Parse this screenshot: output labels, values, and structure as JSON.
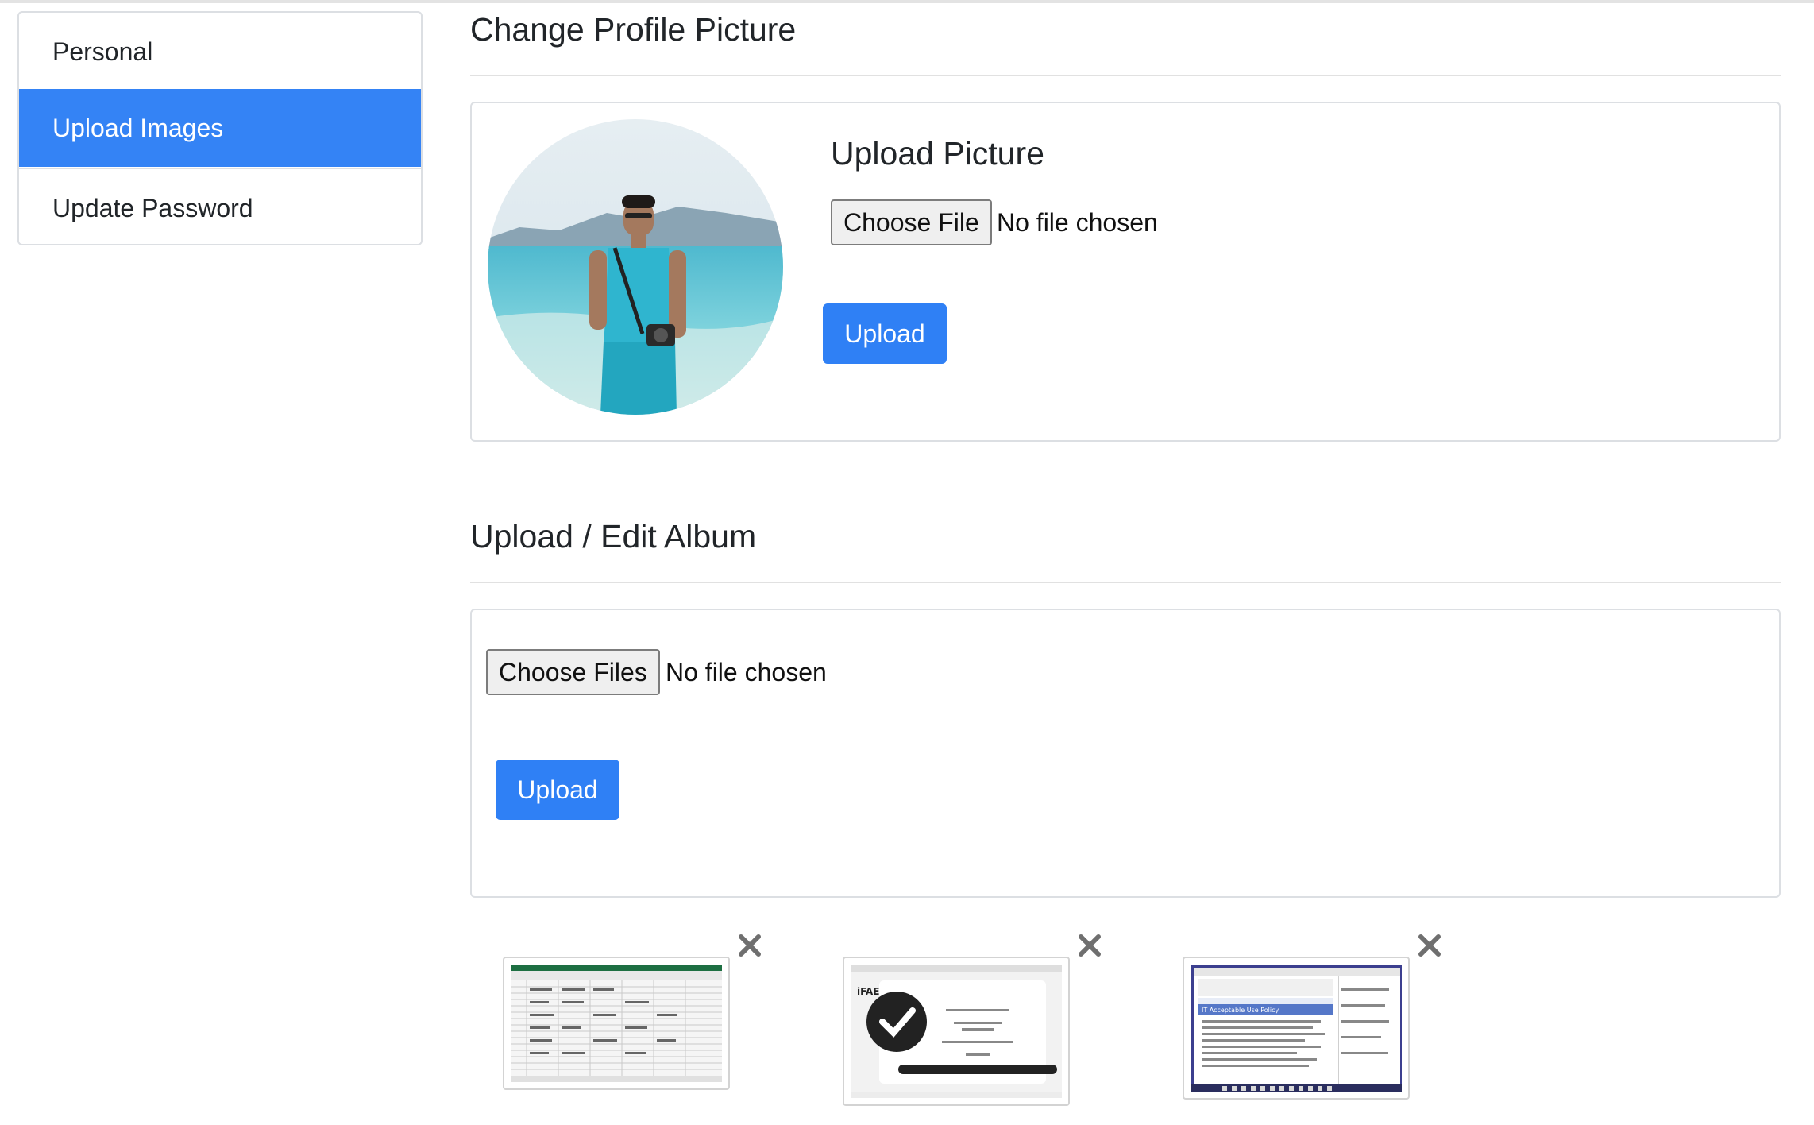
{
  "sidebar": {
    "items": [
      {
        "label": "Personal"
      },
      {
        "label": "Upload Images"
      },
      {
        "label": "Update Password"
      }
    ]
  },
  "profile": {
    "heading": "Change Profile Picture",
    "upload_heading": "Upload Picture",
    "choose_label": "Choose File",
    "no_file": "No file chosen",
    "upload_label": "Upload"
  },
  "album": {
    "heading": "Upload / Edit Album",
    "choose_label": "Choose Files",
    "no_file": "No file chosen",
    "upload_label": "Upload",
    "thumbnails": [
      {
        "kind": "spreadsheet-screenshot"
      },
      {
        "kind": "payment-confirmation-screenshot"
      },
      {
        "kind": "it-policy-screenshot"
      }
    ]
  },
  "colors": {
    "primary": "#2f80f5",
    "active_item": "#3483f5",
    "border": "#dcdfe3",
    "text": "#212529"
  },
  "icons": {
    "delete": "close-icon"
  }
}
